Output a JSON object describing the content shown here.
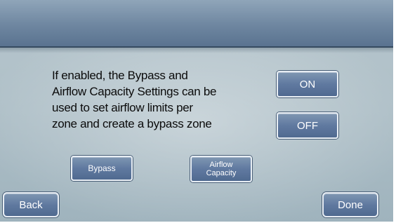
{
  "description": {
    "line1": "If enabled, the Bypass and",
    "line2": "Airflow Capacity Settings can be",
    "line3": "used to set airflow limits per",
    "line4": "zone and create a bypass zone"
  },
  "toggle": {
    "on_label": "ON",
    "off_label": "OFF"
  },
  "settings": {
    "bypass_label": "Bypass",
    "airflow_line1": "Airflow",
    "airflow_line2": "Capacity"
  },
  "nav": {
    "back_label": "Back",
    "done_label": "Done"
  }
}
